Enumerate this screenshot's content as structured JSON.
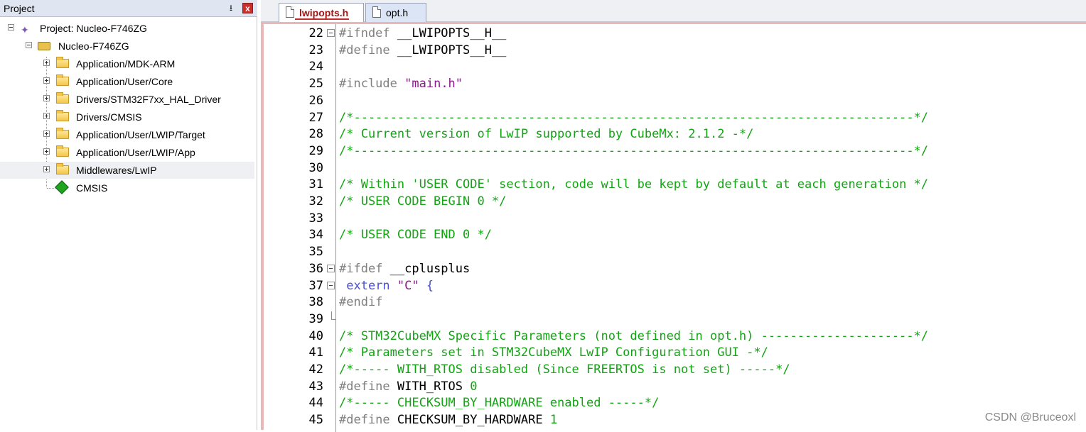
{
  "panel": {
    "title": "Project",
    "pin_glyph": "⭳",
    "close_glyph": "x"
  },
  "tree": {
    "project": "Project: Nucleo-F746ZG",
    "target": "Nucleo-F746ZG",
    "groups": [
      "Application/MDK-ARM",
      "Application/User/Core",
      "Drivers/STM32F7xx_HAL_Driver",
      "Drivers/CMSIS",
      "Application/User/LWIP/Target",
      "Application/User/LWIP/App",
      "Middlewares/LwIP"
    ],
    "component": "CMSIS"
  },
  "tabs": [
    {
      "label": "lwipopts.h",
      "active": true
    },
    {
      "label": "opt.h",
      "active": false
    }
  ],
  "code": {
    "lines": [
      {
        "n": "22",
        "fold": "open",
        "tokens": [
          [
            "c-dir",
            "#ifndef"
          ],
          [
            "c-id",
            " __LWIPOPTS__H__"
          ]
        ]
      },
      {
        "n": "23",
        "tokens": [
          [
            "c-dir",
            "#define"
          ],
          [
            "c-id",
            " __LWIPOPTS__H__"
          ]
        ]
      },
      {
        "n": "24",
        "tokens": []
      },
      {
        "n": "25",
        "tokens": [
          [
            "c-dir",
            "#include"
          ],
          [
            "c-id",
            " "
          ],
          [
            "c-str",
            "\"main.h\""
          ]
        ]
      },
      {
        "n": "26",
        "tokens": []
      },
      {
        "n": "27",
        "tokens": [
          [
            "c-com",
            "/*-----------------------------------------------------------------------------*/"
          ]
        ]
      },
      {
        "n": "28",
        "tokens": [
          [
            "c-com",
            "/* Current version of LwIP supported by CubeMx: 2.1.2 -*/"
          ]
        ]
      },
      {
        "n": "29",
        "tokens": [
          [
            "c-com",
            "/*-----------------------------------------------------------------------------*/"
          ]
        ]
      },
      {
        "n": "30",
        "tokens": []
      },
      {
        "n": "31",
        "tokens": [
          [
            "c-com",
            "/* Within 'USER CODE' section, code will be kept by default at each generation */"
          ]
        ]
      },
      {
        "n": "32",
        "tokens": [
          [
            "c-com",
            "/* USER CODE BEGIN 0 */"
          ]
        ]
      },
      {
        "n": "33",
        "tokens": []
      },
      {
        "n": "34",
        "tokens": [
          [
            "c-com",
            "/* USER CODE END 0 */"
          ]
        ]
      },
      {
        "n": "35",
        "tokens": []
      },
      {
        "n": "36",
        "fold": "open",
        "tokens": [
          [
            "c-dir",
            "#ifdef"
          ],
          [
            "c-id",
            " __cplusplus"
          ]
        ]
      },
      {
        "n": "37",
        "fold": "open",
        "tokens": [
          [
            "c-id",
            " "
          ],
          [
            "c-kw",
            "extern"
          ],
          [
            "c-id",
            " "
          ],
          [
            "c-str",
            "\"C\""
          ],
          [
            "c-id",
            " "
          ],
          [
            "c-brace",
            "{"
          ]
        ]
      },
      {
        "n": "38",
        "tokens": [
          [
            "c-dir",
            "#endif"
          ]
        ]
      },
      {
        "n": "39",
        "fold": "end",
        "tokens": []
      },
      {
        "n": "40",
        "tokens": [
          [
            "c-com",
            "/* STM32CubeMX Specific Parameters (not defined in opt.h) ---------------------*/"
          ]
        ]
      },
      {
        "n": "41",
        "tokens": [
          [
            "c-com",
            "/* Parameters set in STM32CubeMX LwIP Configuration GUI -*/"
          ]
        ]
      },
      {
        "n": "42",
        "tokens": [
          [
            "c-com",
            "/*----- WITH_RTOS disabled (Since FREERTOS is not set) -----*/"
          ]
        ]
      },
      {
        "n": "43",
        "tokens": [
          [
            "c-dir",
            "#define"
          ],
          [
            "c-id",
            " WITH_RTOS "
          ],
          [
            "c-num",
            "0"
          ]
        ]
      },
      {
        "n": "44",
        "tokens": [
          [
            "c-com",
            "/*----- CHECKSUM_BY_HARDWARE enabled -----*/"
          ]
        ]
      },
      {
        "n": "45",
        "tokens": [
          [
            "c-dir",
            "#define"
          ],
          [
            "c-id",
            " CHECKSUM_BY_HARDWARE "
          ],
          [
            "c-num",
            "1"
          ]
        ]
      }
    ]
  },
  "watermark": "CSDN @Bruceoxl"
}
